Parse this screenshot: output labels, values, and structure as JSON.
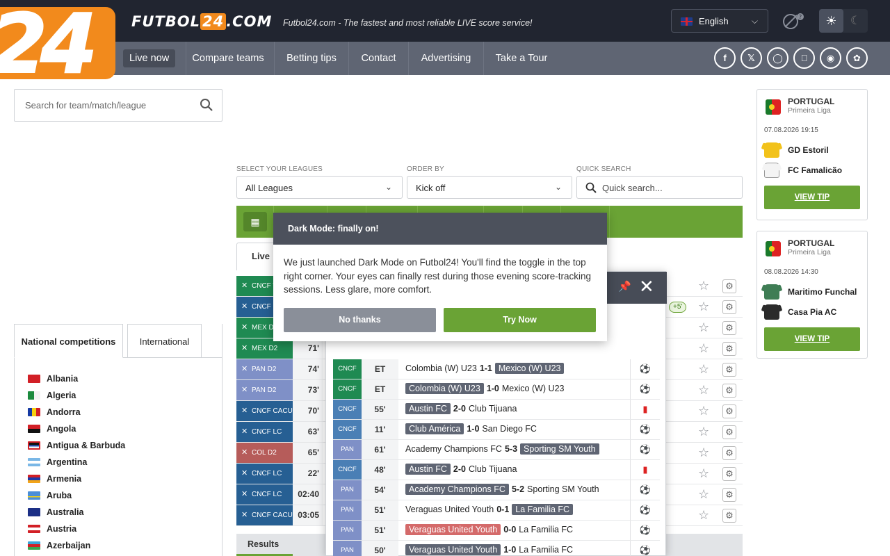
{
  "header": {
    "logo_mark": "24",
    "brand_prefix": "FUTBOL",
    "brand_highlight": "24",
    "brand_suffix": ".COM",
    "tagline": "Futbol24.com - The fastest and most reliable LIVE score service!",
    "language": "English",
    "colors": {
      "topbar": "#212530",
      "navbar": "#5f6573",
      "accent": "#f28a1c",
      "green": "#6aa335"
    }
  },
  "nav": {
    "items": [
      "Live now",
      "Compare teams",
      "Betting tips",
      "Contact",
      "Advertising",
      "Take a Tour"
    ],
    "social": [
      "facebook-icon",
      "x-icon",
      "instagram-icon",
      "apple-icon",
      "android-icon",
      "huawei-icon"
    ]
  },
  "search": {
    "placeholder": "Search for team/match/league"
  },
  "competition_tabs": {
    "national": "National competitions",
    "international": "International"
  },
  "countries": [
    "Albania",
    "Algeria",
    "Andorra",
    "Angola",
    "Antigua & Barbuda",
    "Argentina",
    "Armenia",
    "Aruba",
    "Australia",
    "Austria",
    "Azerbaijan"
  ],
  "filters": {
    "leagues_label": "SELECT YOUR LEAGUES",
    "leagues_value": "All Leagues",
    "order_label": "ORDER BY",
    "order_value": "Kick off",
    "quick_label": "QUICK SEARCH",
    "quick_placeholder": "Quick search..."
  },
  "live_tab": "Live",
  "live_rows": [
    {
      "league": "CNCF W",
      "time": "",
      "color": "green"
    },
    {
      "league": "CNCF LC",
      "time": "",
      "color": "blue"
    },
    {
      "league": "MEX D2",
      "time": "",
      "color": "green"
    },
    {
      "league": "MEX D2",
      "time": "71'",
      "color": "green"
    },
    {
      "league": "PAN D2",
      "time": "74'",
      "color": "pan"
    },
    {
      "league": "PAN D2",
      "time": "73'",
      "color": "pan"
    },
    {
      "league": "CNCF CACUP",
      "time": "70'",
      "color": "blue"
    },
    {
      "league": "CNCF LC",
      "time": "63'",
      "color": "blue"
    },
    {
      "league": "COL D2",
      "time": "65'",
      "color": "col"
    },
    {
      "league": "CNCF LC",
      "time": "22'",
      "color": "blue"
    },
    {
      "league": "CNCF LC",
      "time": "02:40",
      "color": "blue"
    },
    {
      "league": "CNCF CACUP",
      "time": "03:05",
      "color": "blue"
    }
  ],
  "plus_badge": "+5'",
  "results_label": "Results",
  "modal": {
    "title": "Dark Mode: finally on!",
    "body": "We just launched Dark Mode on Futbol24! You'll find the toggle in the top right corner. Your eyes can finally rest during those evening score-tracking sessions. Less glare, more comfort.",
    "no_label": "No thanks",
    "yes_label": "Try Now"
  },
  "panel_rows": [
    {
      "league": "CNCF",
      "time": "ET",
      "home": "Colombia (W) U23",
      "score": "1-1",
      "away": "Mexico (W) U23",
      "hl": "away",
      "event": "ball",
      "color": "green"
    },
    {
      "league": "CNCF",
      "time": "ET",
      "home": "Colombia (W) U23",
      "score": "1-0",
      "away": "Mexico (W) U23",
      "hl": "home",
      "event": "ball",
      "color": "green"
    },
    {
      "league": "CNCF",
      "time": "55'",
      "home": "Austin FC",
      "score": "2-0",
      "away": "Club Tijuana",
      "hl": "home",
      "event": "redcard-x",
      "color": "blue"
    },
    {
      "league": "CNCF",
      "time": "11'",
      "home": "Club América",
      "score": "1-0",
      "away": "San Diego FC",
      "hl": "home",
      "event": "ball",
      "color": "blue"
    },
    {
      "league": "PAN",
      "time": "61'",
      "home": "Academy Champions FC",
      "score": "5-3",
      "away": "Sporting SM Youth",
      "hl": "away",
      "event": "ball",
      "color": "pan"
    },
    {
      "league": "CNCF",
      "time": "48'",
      "home": "Austin FC",
      "score": "2-0",
      "away": "Club Tijuana",
      "hl": "home",
      "event": "redcard",
      "color": "blue"
    },
    {
      "league": "PAN",
      "time": "54'",
      "home": "Academy Champions FC",
      "score": "5-2",
      "away": "Sporting SM Youth",
      "hl": "home",
      "event": "ball",
      "color": "pan"
    },
    {
      "league": "PAN",
      "time": "51'",
      "home": "Veraguas United Youth",
      "score": "0-1",
      "away": "La Familia FC",
      "hl": "away",
      "event": "ball",
      "color": "pan"
    },
    {
      "league": "PAN",
      "time": "51'",
      "home": "Veraguas United Youth",
      "score": "0-0",
      "away": "La Familia FC",
      "hl": "home-red",
      "event": "ball-x",
      "color": "pan"
    },
    {
      "league": "PAN",
      "time": "50'",
      "home": "Veraguas United Youth",
      "score": "1-0",
      "away": "La Familia FC",
      "hl": "home",
      "event": "ball",
      "color": "pan"
    }
  ],
  "tips": [
    {
      "country": "PORTUGAL",
      "league": "Primeira Liga",
      "datetime": "07.08.2026  19:15",
      "home": "GD Estoril",
      "away": "FC Famalicão",
      "home_color": "#f2c21b",
      "away_color": "#f4f4f4",
      "button": "VIEW TIP"
    },
    {
      "country": "PORTUGAL",
      "league": "Primeira Liga",
      "datetime": "08.08.2026  14:30",
      "home": "Maritimo Funchal",
      "away": "Casa Pia AC",
      "home_color": "#3f7d55",
      "away_color": "#2b2b2b",
      "button": "VIEW TIP"
    }
  ]
}
